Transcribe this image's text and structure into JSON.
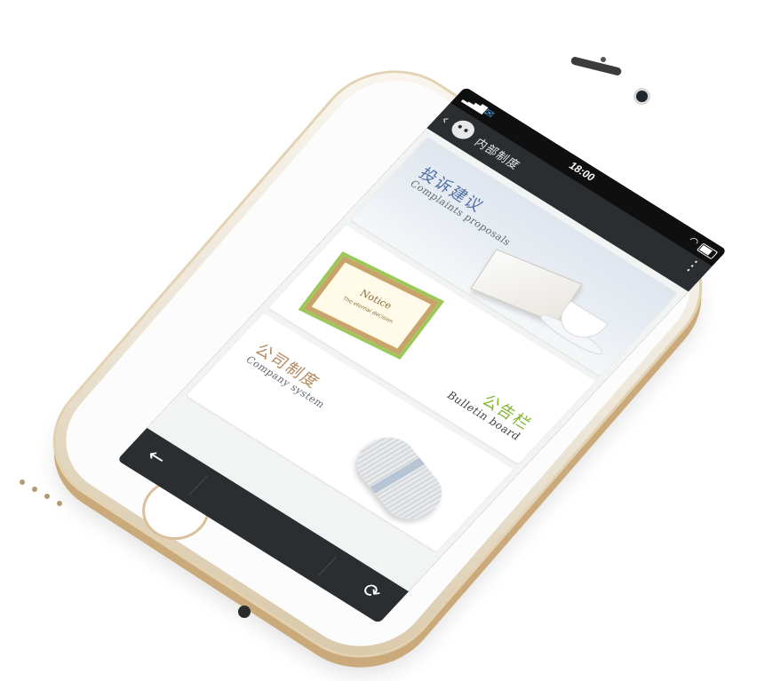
{
  "status_bar": {
    "time": "18:00",
    "icons": [
      "signal-icon",
      "notification-icon",
      "wifi-icon",
      "battery-icon"
    ]
  },
  "action_bar": {
    "title": "内部制度",
    "icons": [
      "back-chevron-icon",
      "wechat-icon",
      "more-icon"
    ]
  },
  "cards": [
    {
      "zh": "投诉建议",
      "en": "Complaints proposals",
      "accent": "#4f6fa8"
    },
    {
      "zh": "公告栏",
      "en": "Bulletin board",
      "accent": "#83b431",
      "illustration": {
        "title": "Notice",
        "subtitle": "The eternal decision"
      }
    },
    {
      "zh": "公司制度",
      "en": "Company system",
      "accent": "#b4895e"
    }
  ],
  "bottom_bar": {
    "icons": [
      "back-arrow-icon",
      "refresh-icon"
    ]
  },
  "colors": {
    "bar_background": "#2b2e31",
    "phone_gold": "#d9c8a8"
  }
}
